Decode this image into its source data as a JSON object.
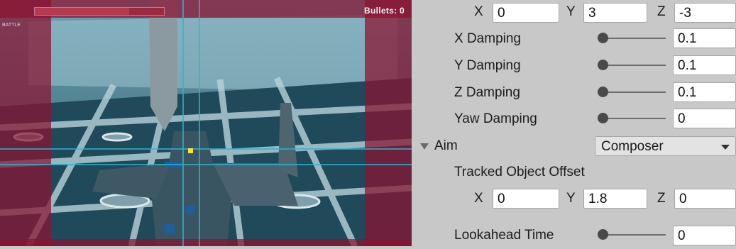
{
  "game_view": {
    "bullets_label": "Bullets: 0",
    "corner_text": "BATTLE",
    "health_fraction": 0.73,
    "colors": {
      "overlay": "#8a1230",
      "sky": "#3b6f80",
      "tile": "#1f4555",
      "guide": "#27b8d0"
    }
  },
  "inspector": {
    "top_offset": {
      "x_label": "X",
      "x_value": "0",
      "y_label": "Y",
      "y_value": "3",
      "z_label": "Z",
      "z_value": "-3"
    },
    "x_damping": {
      "label": "X Damping",
      "value": "0.1"
    },
    "y_damping": {
      "label": "Y Damping",
      "value": "0.1"
    },
    "z_damping": {
      "label": "Z Damping",
      "value": "0.1"
    },
    "yaw_damping": {
      "label": "Yaw Damping",
      "value": "0"
    },
    "aim": {
      "label": "Aim",
      "selected": "Composer"
    },
    "tracked_offset": {
      "label": "Tracked Object Offset",
      "x_label": "X",
      "x_value": "0",
      "y_label": "Y",
      "y_value": "1.8",
      "z_label": "Z",
      "z_value": "0"
    },
    "lookahead_time": {
      "label": "Lookahead Time",
      "value": "0"
    }
  }
}
